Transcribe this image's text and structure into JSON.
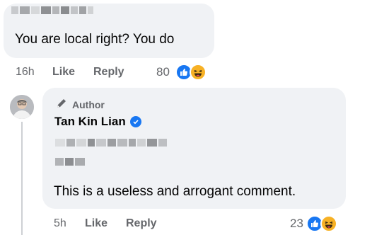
{
  "top_comment": {
    "text": "You are local right? You do",
    "time": "16h",
    "like_label": "Like",
    "reply_label": "Reply",
    "reaction_count": "80",
    "reactions": [
      "like-reaction-icon",
      "haha-reaction-icon"
    ]
  },
  "reply": {
    "author_badge": "Author",
    "author_name": "Tan Kin Lian",
    "text": "This is a useless and arrogant comment.",
    "time": "5h",
    "like_label": "Like",
    "reply_label": "Reply",
    "reaction_count": "23",
    "reactions": [
      "like-reaction-icon",
      "haha-reaction-icon"
    ]
  },
  "colors": {
    "bubble": "#f0f2f5",
    "meta_text": "#65676b",
    "like_blue": "#1877f2",
    "haha_yellow": "#f7b125"
  }
}
